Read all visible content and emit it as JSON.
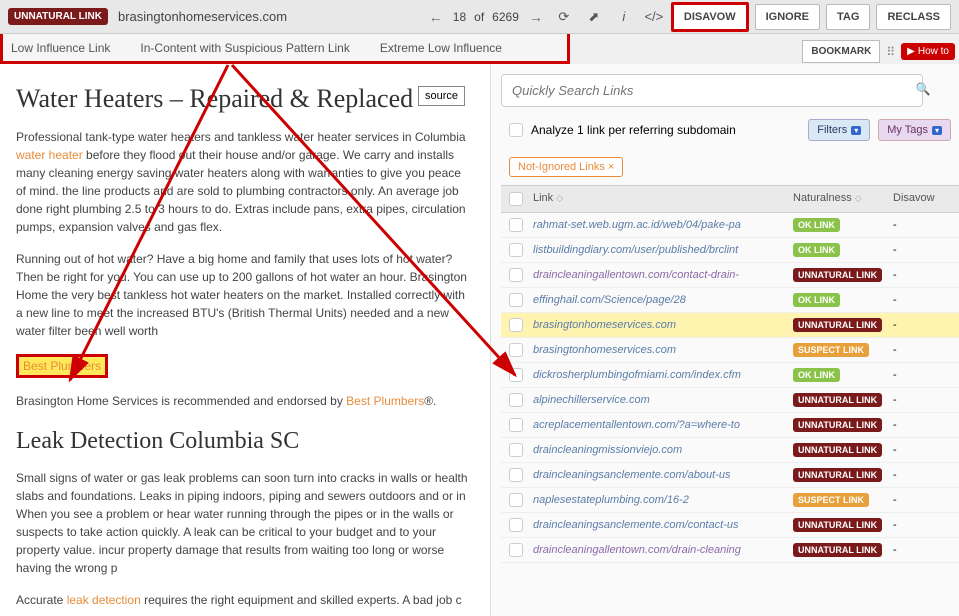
{
  "topbar": {
    "badge": "UNNATURAL LINK",
    "domain": "brasingtonhomeservices.com",
    "position": "18",
    "total": "6269",
    "of": "of"
  },
  "actions": {
    "disavow": "DISAVOW",
    "ignore": "IGNORE",
    "tag": "TAG",
    "reclass": "RECLASS",
    "bookmark": "BOOKMARK",
    "howto": "How to"
  },
  "tags": {
    "low_influence": "Low Influence Link",
    "suspicious": "In-Content with Suspicious Pattern Link",
    "extreme_low": "Extreme Low Influence"
  },
  "source_label": "source",
  "article": {
    "h1": "Water Heaters – Repaired & Replaced",
    "p1a": "Professional tank-type water heaters and tankless water heater services in Columbia",
    "p1_link": "water heater",
    "p1b": " before they flood out their house and/or garage. We carry and installs many cleaning energy saving water heaters along with warranties to give you peace of mind. the line products and are sold to plumbing contractors only. An average job done right plumbing 2.5 to 3 hours to do. Extras include pans, extra pipes, circulation pumps, expansion valves and gas flex.",
    "p2": "Running out of hot water? Have a big home and family that uses lots of hot water? Then be right for you. You can use up to 200 gallons of hot water an hour. Brasington Home the very best tankless hot water heaters on the market. Installed correctly with a new line to meet the increased BTU's (British Thermal Units) needed and a new water filter been well worth",
    "best_plumbers": "Best Plumbers",
    "p3a": "Brasington Home Services is recommended and endorsed by ",
    "p3_link": "Best Plumbers",
    "p3b": "®.",
    "h2": "Leak Detection Columbia SC",
    "p4": "Small signs of water or gas leak problems can soon turn into cracks in walls or health slabs and foundations. Leaks in piping indoors, piping and sewers outdoors and or in When you see a problem or hear water running through the pipes or in the walls or suspects to take action quickly. A leak can be critical to your budget and to your property value. incur property damage that results from waiting too long or worse having the wrong p",
    "p5a": "Accurate ",
    "p5_link": "leak detection",
    "p5b": " requires the right equipment and skilled experts. A bad job c"
  },
  "right": {
    "search_placeholder": "Quickly Search Links",
    "analyze": "Analyze 1 link per referring subdomain",
    "filters": "Filters",
    "mytags": "My Tags",
    "not_ignored": "Not-Ignored Links ×",
    "col_link": "Link",
    "col_nat": "Naturalness",
    "col_dis": "Disavow"
  },
  "links": [
    {
      "url": "rahmat-set.web.ugm.ac.id/web/04/pake-pa",
      "badge": "OK LINK",
      "cls": "ok"
    },
    {
      "url": "listbuildingdiary.com/user/published/brclint",
      "badge": "OK LINK",
      "cls": "ok"
    },
    {
      "url": "draincleaningallentown.com/contact-drain-",
      "badge": "UNNATURAL LINK",
      "cls": "unnatural",
      "purple": true
    },
    {
      "url": "effinghail.com/Science/page/28",
      "badge": "OK LINK",
      "cls": "ok"
    },
    {
      "url": "brasingtonhomeservices.com",
      "badge": "UNNATURAL LINK",
      "cls": "unnatural",
      "hl": true
    },
    {
      "url": "brasingtonhomeservices.com",
      "badge": "SUSPECT LINK",
      "cls": "suspect"
    },
    {
      "url": "dickrosherplumbingofmiami.com/index.cfm",
      "badge": "OK LINK",
      "cls": "ok"
    },
    {
      "url": "alpinechillerservice.com",
      "badge": "UNNATURAL LINK",
      "cls": "unnatural"
    },
    {
      "url": "acreplacementallentown.com/?a=where-to",
      "badge": "UNNATURAL LINK",
      "cls": "unnatural"
    },
    {
      "url": "draincleaningmissionviejo.com",
      "badge": "UNNATURAL LINK",
      "cls": "unnatural"
    },
    {
      "url": "draincleaningsanclemente.com/about-us",
      "badge": "UNNATURAL LINK",
      "cls": "unnatural"
    },
    {
      "url": "naplesestateplumbing.com/16-2",
      "badge": "SUSPECT LINK",
      "cls": "suspect"
    },
    {
      "url": "draincleaningsanclemente.com/contact-us",
      "badge": "UNNATURAL LINK",
      "cls": "unnatural"
    },
    {
      "url": "draincleaningallentown.com/drain-cleaning",
      "badge": "UNNATURAL LINK",
      "cls": "unnatural",
      "purple": true
    }
  ]
}
